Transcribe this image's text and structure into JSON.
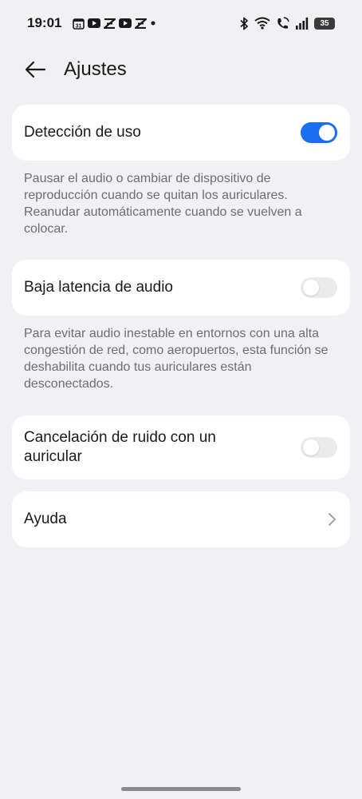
{
  "status_bar": {
    "time": "19:01",
    "battery": "35",
    "notification_icons": [
      "calendar-icon",
      "youtube-icon",
      "capcut-icon",
      "youtube-icon",
      "capcut-icon",
      "dot-icon"
    ],
    "system_icons": [
      "bluetooth-icon",
      "wifi-icon",
      "wifi-call-icon",
      "signal-icon",
      "battery-icon"
    ]
  },
  "header": {
    "title": "Ajustes"
  },
  "settings": [
    {
      "label": "Detección de uso",
      "toggle": true,
      "description": "Pausar el audio o cambiar de dispositivo de reproducción cuando se quitan los auriculares. Reanudar automáticamente cuando se vuelven a colocar."
    },
    {
      "label": "Baja latencia de audio",
      "toggle": false,
      "description": "Para evitar audio inestable en entornos con una alta congestión de red, como aeropuertos, esta función se deshabilita cuando tus auriculares están desconectados."
    },
    {
      "label": "Cancelación de ruido con un auricular",
      "toggle": false
    },
    {
      "label": "Ayuda"
    }
  ],
  "colors": {
    "background": "#f1f1f3",
    "card": "#ffffff",
    "accent": "#1a6ff0",
    "toggle_off": "#ebebeb",
    "secondary_text": "#6e6e70"
  }
}
